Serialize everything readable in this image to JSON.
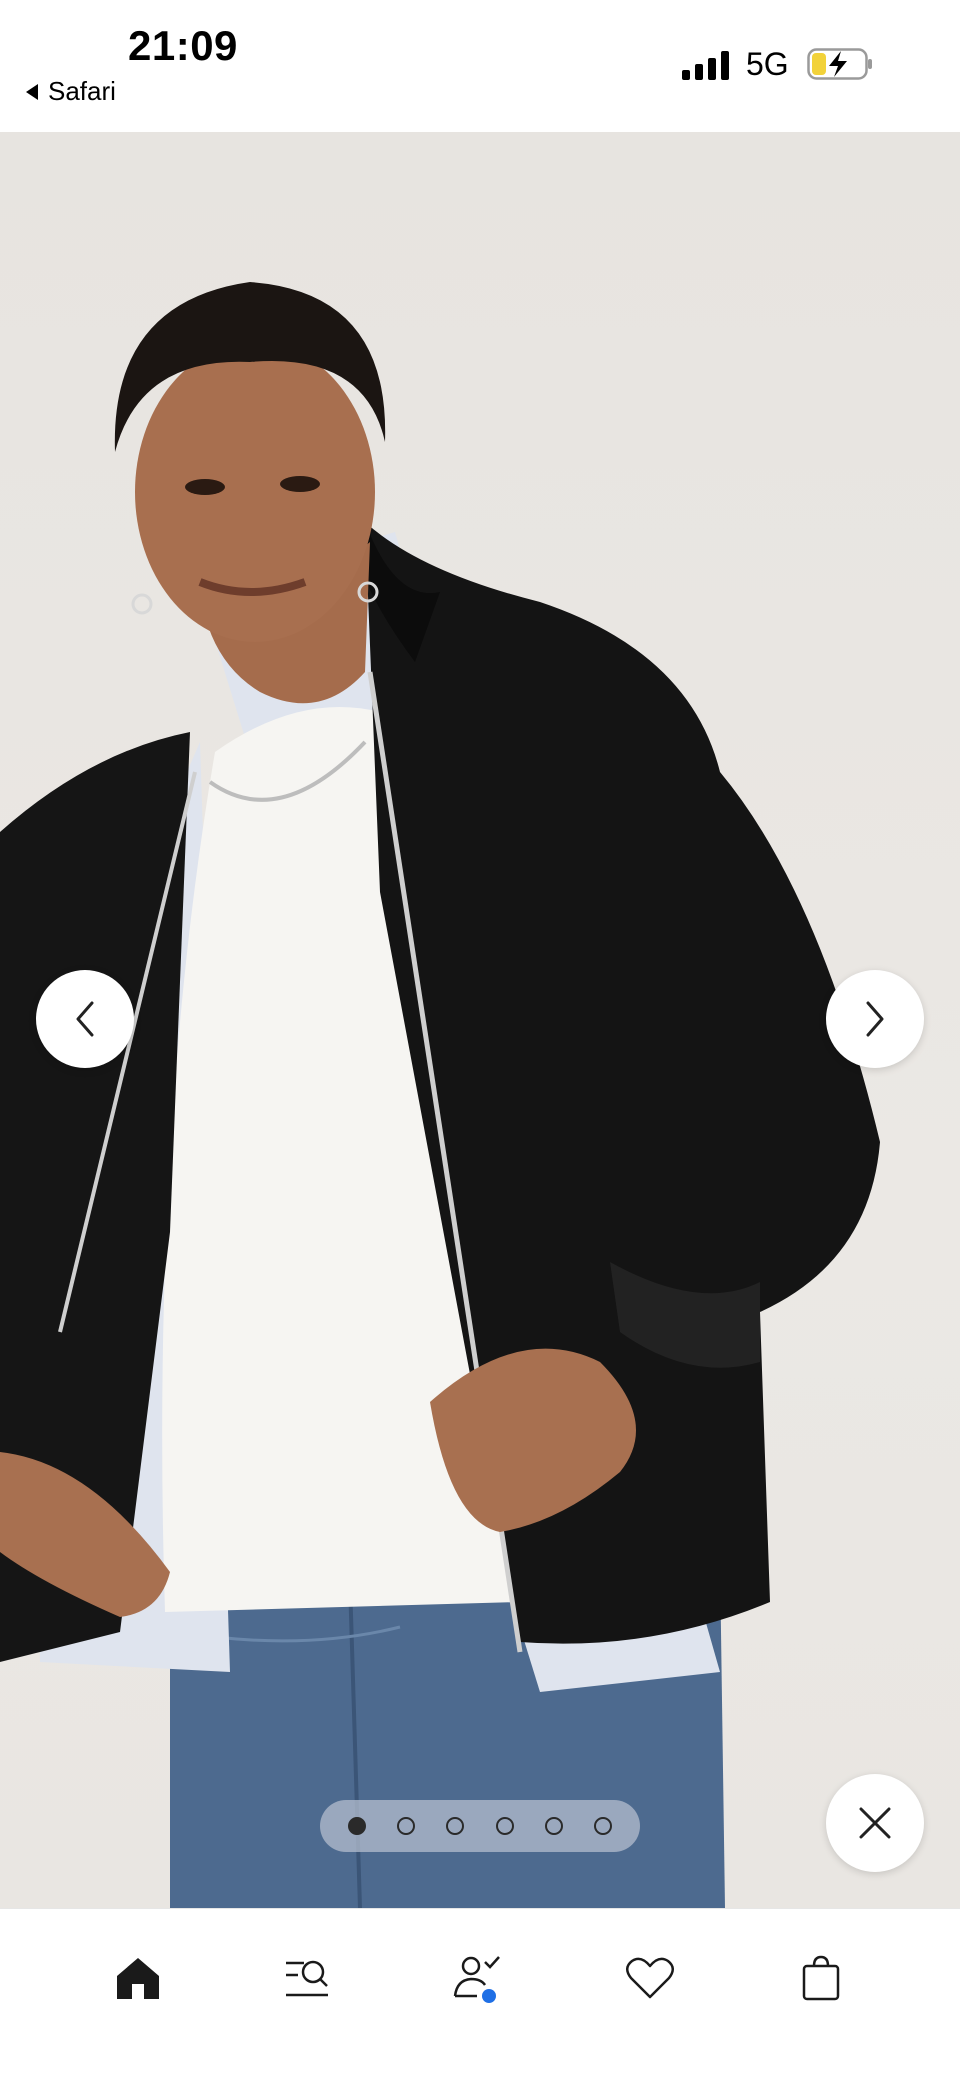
{
  "status_bar": {
    "time": "21:09",
    "back_app": "Safari",
    "network": "5G",
    "icons": [
      "signal-icon",
      "battery-charging-icon"
    ]
  },
  "gallery": {
    "image_description_name": "product-photo",
    "total_images": 6,
    "active_index": 0,
    "icons": [
      "chevron-left-icon",
      "chevron-right-icon",
      "close-icon"
    ]
  },
  "tabbar": {
    "items": [
      {
        "name": "home",
        "icon": "home-icon",
        "active": true
      },
      {
        "name": "search",
        "icon": "search-icon",
        "active": false
      },
      {
        "name": "account",
        "icon": "account-check-icon",
        "active": false,
        "badge_color": "#1f6fe5"
      },
      {
        "name": "favorites",
        "icon": "heart-icon",
        "active": false
      },
      {
        "name": "bag",
        "icon": "shopping-bag-icon",
        "active": false
      }
    ]
  },
  "colors": {
    "background": "#e9e6e2",
    "jacket": "#141414",
    "accent": "#1f6fe5"
  }
}
